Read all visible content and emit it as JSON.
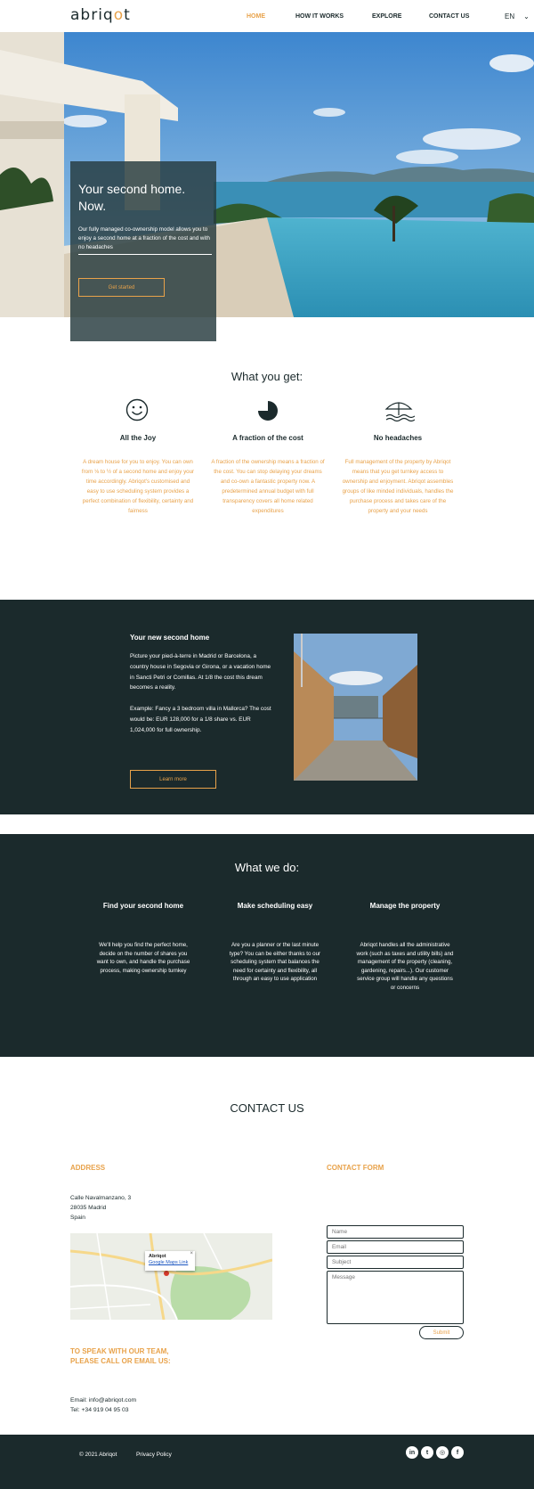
{
  "header": {
    "logo_prefix": "abriq",
    "logo_o": "o",
    "logo_suffix": "t",
    "nav": [
      {
        "label": "HOME",
        "active": true
      },
      {
        "label": "HOW IT WORKS",
        "active": false
      },
      {
        "label": "EXPLORE",
        "active": false
      },
      {
        "label": "CONTACT US",
        "active": false
      }
    ],
    "language": "EN"
  },
  "hero": {
    "title": "Your second home. Now.",
    "text": "Our fully managed co-ownership model allows you to enjoy a second home at a fraction of the cost and with no headaches",
    "button": "Get started"
  },
  "what_you_get": {
    "title": "What you get:",
    "items": [
      {
        "icon": "smiley-icon",
        "heading": "All the Joy",
        "text": "A dream house for you to enjoy. You can own from ⅛ to ½ of a second home and enjoy your time accordingly. Abriqot's customised and easy to use scheduling system provides a perfect combination of flexibility, certainty and fairness"
      },
      {
        "icon": "pie-fraction-icon",
        "heading": "A fraction of the cost",
        "text": "A fraction of the ownership means a fraction of the cost. You can stop delaying your dreams and co-own a fantastic property now. A predetermined annual budget with full transparency covers all home related expenditures"
      },
      {
        "icon": "beach-umbrella-icon",
        "heading": "No headaches",
        "text": "Full management of the property by Abriqot means that you get turnkey access to ownership and enjoyment. Abriqot assembles groups of like minded individuals, handles the purchase process and takes care of the property and your needs"
      }
    ]
  },
  "new_home": {
    "heading": "Your new second home",
    "para1": "Picture your pied-à-terre in Madrid or Barcelona, a country house in Segovia or Girona, or a vacation home in Sancti Petri or Comillas.  At 1/8 the cost this dream becomes a reality.",
    "para2": "Example: Fancy a 3 bedroom villa in Mallorca? The cost would be: EUR 128,000 for a 1/8 share vs. EUR 1,024,000 for full ownership.",
    "button": "Learn more"
  },
  "what_we_do": {
    "title": "What we do:",
    "items": [
      {
        "heading": "Find your second home",
        "text": "We'll help you find the perfect home, decide on the number of shares you want to own, and handle the purchase process, making ownership turnkey"
      },
      {
        "heading": "Make scheduling easy",
        "text": "Are you a planner or the last minute type?  You can be either thanks to our scheduling system that balances the need for certainty and flexibility, all through an easy to use application"
      },
      {
        "heading": "Manage the property",
        "text": "Abriqot handles all the administrative work (such as taxes and utility bills) and management of the property (cleaning, gardening, repairs...). Our customer service group will handle any questions or concerns"
      }
    ]
  },
  "contact": {
    "title": "CONTACT US",
    "address_heading": "ADDRESS",
    "address_lines": [
      "Calle Navalmanzano, 3",
      "28035 Madrid",
      "Spain"
    ],
    "map_popup_name": "Abriqot",
    "map_popup_link": "Google Maps Link",
    "speak_heading_1": "TO SPEAK WITH OUR TEAM,",
    "speak_heading_2": "PLEASE CALL OR EMAIL US:",
    "email": "Email: info@abriqot.com",
    "tel": "Tel: +34 919 04 95 03",
    "form_heading": "CONTACT FORM",
    "form": {
      "name_placeholder": "Name",
      "email_placeholder": "Email",
      "subject_placeholder": "Subject",
      "message_placeholder": "Message",
      "submit": "Submit"
    }
  },
  "footer": {
    "copyright": "© 2021 Abriqot",
    "privacy": "Privacy Policy",
    "social": [
      {
        "icon": "linkedin-icon",
        "glyph": "in"
      },
      {
        "icon": "twitter-icon",
        "glyph": "t"
      },
      {
        "icon": "instagram-icon",
        "glyph": "◎"
      },
      {
        "icon": "facebook-icon",
        "glyph": "f"
      }
    ]
  },
  "colors": {
    "accent": "#e8a24a",
    "dark": "#1b2a2c"
  }
}
